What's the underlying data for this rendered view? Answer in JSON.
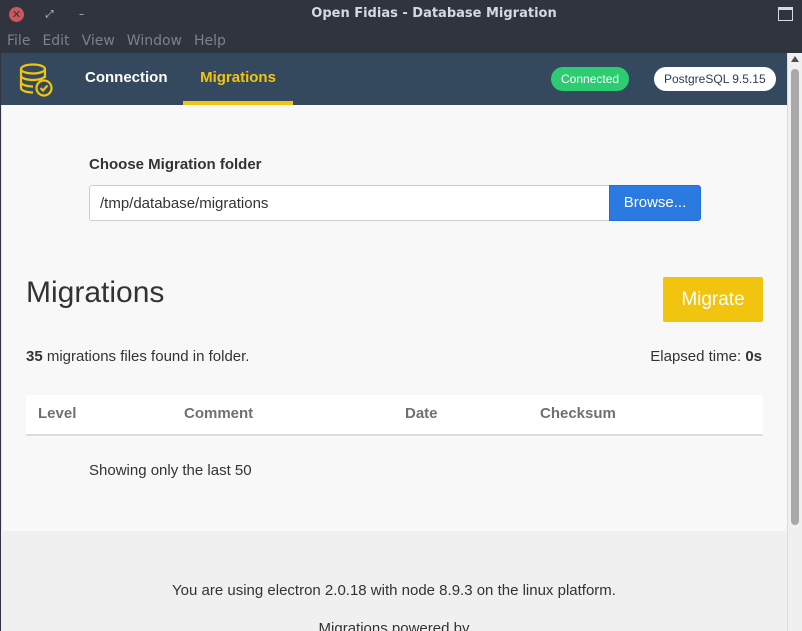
{
  "window": {
    "title": "Open Fidias - Database Migration",
    "close_glyph": "✕",
    "maximize_glyph": "⤢",
    "minimize_glyph": "–"
  },
  "menu": {
    "items": [
      "File",
      "Edit",
      "View",
      "Window",
      "Help"
    ]
  },
  "navbar": {
    "logo_icon": "database-check-icon",
    "tabs": [
      {
        "label": "Connection",
        "active": false
      },
      {
        "label": "Migrations",
        "active": true
      }
    ],
    "status_badge": "Connected",
    "db_badge": "PostgreSQL 9.5.15",
    "colors": {
      "bar": "#34495e",
      "active": "#f1c40f",
      "connected": "#2ecc71"
    }
  },
  "folder": {
    "label": "Choose Migration folder",
    "path": "/tmp/database/migrations",
    "browse_label": "Browse..."
  },
  "migrations": {
    "heading": "Migrations",
    "migrate_label": "Migrate",
    "found_count": "35",
    "found_text": " migrations files found in folder.",
    "elapsed_label": "Elapsed time: ",
    "elapsed_value": "0s",
    "table_headers": [
      "Level",
      "Comment",
      "Date",
      "Checksum"
    ],
    "showing_text": "Showing only the last 50"
  },
  "footer": {
    "electron_line": "You are using electron 2.0.18 with node 8.9.3 on the linux platform.",
    "cut_line": "Migrations powered by"
  }
}
